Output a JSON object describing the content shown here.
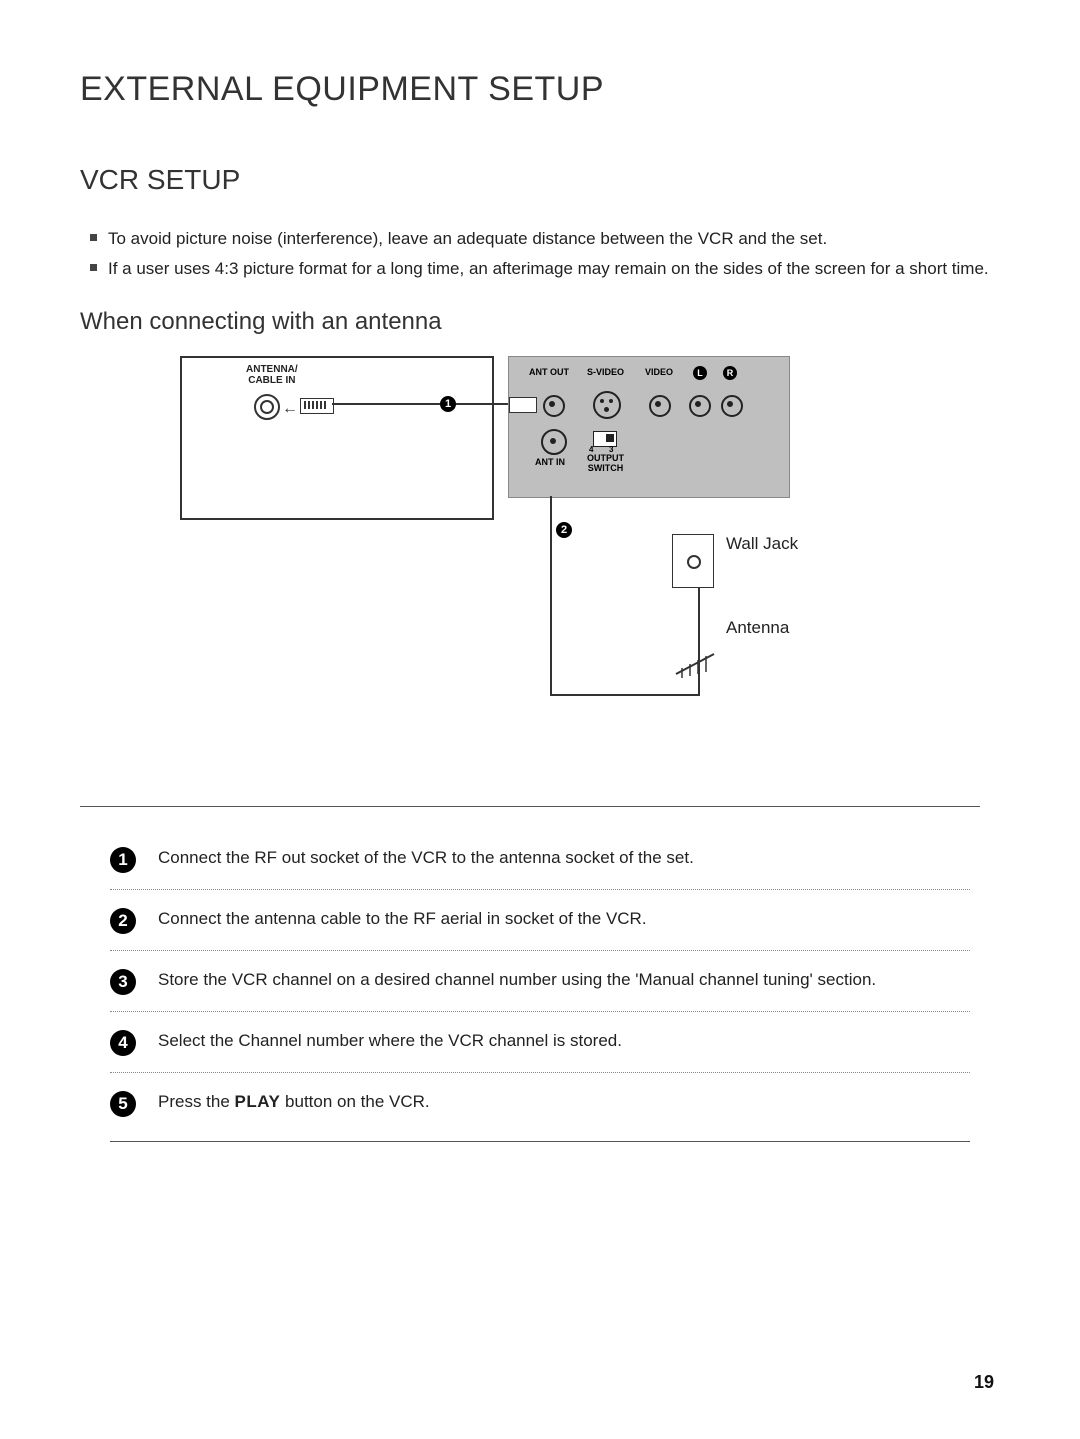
{
  "headings": {
    "h1": "EXTERNAL EQUIPMENT SETUP",
    "h2": "VCR SETUP",
    "h3": "When connecting with an antenna"
  },
  "notes": [
    "To avoid picture noise (interference), leave an adequate distance between the VCR and the set.",
    "If a user uses 4:3 picture format for a long time, an afterimage may remain on the sides of the screen for a short time."
  ],
  "diagram": {
    "tv_port_label": "ANTENNA/\nCABLE IN",
    "vcr_labels": {
      "ant_out": "ANT OUT",
      "s_video": "S-VIDEO",
      "video": "VIDEO",
      "left": "L",
      "right": "R",
      "ant_in": "ANT IN",
      "output_switch": "OUTPUT\nSWITCH",
      "switch_3": "3",
      "switch_4": "4"
    },
    "callouts": {
      "one": "1",
      "two": "2"
    },
    "wall_jack": "Wall Jack",
    "antenna": "Antenna"
  },
  "steps": [
    {
      "n": "1",
      "text": "Connect the RF out socket of the VCR to the antenna socket of the set."
    },
    {
      "n": "2",
      "text": "Connect the antenna cable to the RF aerial in socket of the VCR."
    },
    {
      "n": "3",
      "text": "Store the VCR channel on a desired channel number using the 'Manual channel tuning' section."
    },
    {
      "n": "4",
      "text": "Select the Channel number where the VCR channel is stored."
    },
    {
      "n": "5",
      "prefix": "Press the ",
      "bold": "PLAY",
      "suffix": " button on the VCR."
    }
  ],
  "page_number": "19"
}
